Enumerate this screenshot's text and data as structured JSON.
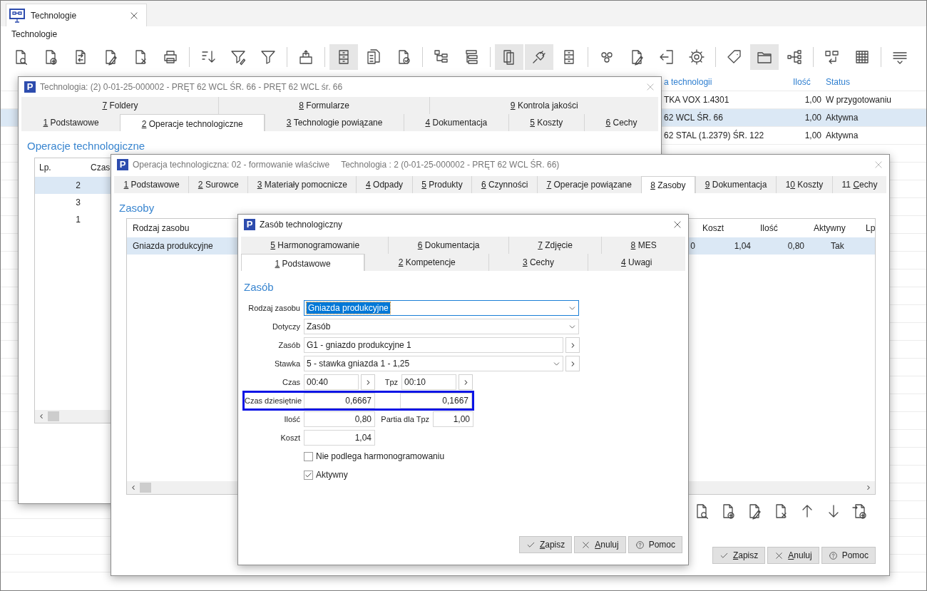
{
  "app_tab": {
    "label": "Technologie"
  },
  "page_title": "Technologie",
  "toolbar": [
    {
      "kind": "doc-search",
      "pressed": false
    },
    {
      "kind": "doc-add",
      "pressed": false
    },
    {
      "kind": "doc-copy",
      "pressed": false
    },
    {
      "kind": "doc-edit",
      "pressed": false
    },
    {
      "kind": "doc-delete",
      "pressed": false
    },
    {
      "kind": "printer",
      "pressed": false
    },
    {
      "kind": "separator"
    },
    {
      "kind": "sort",
      "pressed": false
    },
    {
      "kind": "filter-edit",
      "pressed": false
    },
    {
      "kind": "filter",
      "pressed": false
    },
    {
      "kind": "separator"
    },
    {
      "kind": "tray-upload",
      "pressed": false
    },
    {
      "kind": "separator"
    },
    {
      "kind": "cabinet",
      "pressed": true
    },
    {
      "kind": "doc-list",
      "pressed": false
    },
    {
      "kind": "doc-check",
      "pressed": false
    },
    {
      "kind": "separator"
    },
    {
      "kind": "hierarchy",
      "pressed": false
    },
    {
      "kind": "tree-list",
      "pressed": false
    },
    {
      "kind": "separator"
    },
    {
      "kind": "pages",
      "pressed": true
    },
    {
      "kind": "plug",
      "pressed": true
    },
    {
      "kind": "cabinet",
      "pressed": false
    },
    {
      "kind": "separator"
    },
    {
      "kind": "gears",
      "pressed": false
    },
    {
      "kind": "doc-edit",
      "pressed": false
    },
    {
      "kind": "sign-in",
      "pressed": false
    },
    {
      "kind": "gear",
      "pressed": false
    },
    {
      "kind": "separator"
    },
    {
      "kind": "tag",
      "pressed": false
    },
    {
      "kind": "folder",
      "pressed": true
    },
    {
      "kind": "network",
      "pressed": false
    },
    {
      "kind": "separator"
    },
    {
      "kind": "outdent",
      "pressed": false
    },
    {
      "kind": "grid",
      "pressed": false
    },
    {
      "kind": "separator"
    },
    {
      "kind": "menu-lines",
      "pressed": false
    }
  ],
  "background_list": {
    "columns": [
      {
        "label": "a technologii"
      },
      {
        "label": "Ilość"
      },
      {
        "label": "Status"
      }
    ],
    "rows": [
      {
        "name": "TKA VOX 1.4301",
        "quantity": "1,00",
        "status": "W przygotowaniu",
        "selected": false
      },
      {
        "name": "62 WCL ŚR. 66",
        "quantity": "1,00",
        "status": "Aktywna",
        "selected": true
      },
      {
        "name": "62 STAL (1.2379) ŚR. 122",
        "quantity": "1,00",
        "status": "Aktywna",
        "selected": false
      }
    ]
  },
  "technology_window": {
    "logo": "P",
    "title": "Technologia: (2) 0-01-25-000002 - PRĘT 62 WCL ŚR. 66 - PRĘT 62 WCL śr. 66",
    "tab_rows": [
      [
        {
          "key": "7",
          "post": " Foldery",
          "selected": false
        },
        {
          "key": "8",
          "post": " Formularze",
          "selected": false
        },
        {
          "key": "9",
          "post": " Kontrola jakości",
          "selected": false
        }
      ],
      [
        {
          "key": "1",
          "post": " Podstawowe",
          "selected": false
        },
        {
          "key": "2",
          "post": " Operacje technologiczne",
          "selected": true
        },
        {
          "key": "3",
          "post": " Technologie powiązane",
          "selected": false
        },
        {
          "key": "4",
          "post": " Dokumentacja",
          "selected": false
        },
        {
          "key": "5",
          "post": " Koszty",
          "selected": false
        },
        {
          "key": "6",
          "post": " Cechy",
          "selected": false
        }
      ]
    ],
    "section_title": "Operacje technologiczne",
    "table": {
      "columns": [
        {
          "label": "Lp."
        },
        {
          "label": "Czas"
        }
      ],
      "rows": [
        {
          "lp": "2",
          "selected": true
        },
        {
          "lp": "3",
          "selected": false
        },
        {
          "lp": "1",
          "selected": false
        }
      ]
    }
  },
  "operation_window": {
    "logo": "P",
    "title": "Operacja technologiczna: 02 - formowanie właściwe",
    "subtitle": "Technologia : 2 (0-01-25-000002 - PRĘT 62 WCL ŚR. 66)",
    "tabs": [
      {
        "key": "1",
        "post": " Podstawowe",
        "selected": false
      },
      {
        "key": "2",
        "post": " Surowce",
        "selected": false
      },
      {
        "key": "3",
        "post": " Materiały pomocnicze",
        "selected": false
      },
      {
        "key": "4",
        "post": " Odpady",
        "selected": false
      },
      {
        "key": "5",
        "post": " Produkty",
        "selected": false
      },
      {
        "key": "6",
        "post": " Czynności",
        "selected": false
      },
      {
        "key": "7",
        "post": " Operacje powiązane",
        "selected": false
      },
      {
        "key": "8",
        "post": " Zasoby",
        "selected": true
      },
      {
        "key": "9",
        "post": " Dokumentacja",
        "selected": false
      },
      {
        "pre": "1",
        "key": "0",
        "post": " Koszty",
        "selected": false
      },
      {
        "pre": "11 ",
        "key": "C",
        "post": "echy",
        "selected": false
      }
    ],
    "section_title": "Zasoby",
    "table": {
      "columns": {
        "rodzaj_zasobu": "Rodzaj zasobu",
        "koszt": "Koszt",
        "ilosc": "Ilość",
        "aktywny": "Aktywny",
        "lp": "Lp"
      },
      "rows": [
        {
          "rodzaj_zasobu": "Gniazda produkcyjne",
          "column_2": "0",
          "koszt": "1,04",
          "ilosc": "0,80",
          "aktywny": "Tak",
          "selected": true
        }
      ]
    },
    "tools": [
      {
        "kind": "doc-search"
      },
      {
        "kind": "doc-add"
      },
      {
        "kind": "doc-edit"
      },
      {
        "kind": "doc-delete"
      },
      {
        "kind": "arrow-up"
      },
      {
        "kind": "arrow-down"
      },
      {
        "kind": "doc-import"
      }
    ],
    "buttons": [
      {
        "kind": "save",
        "key": "Z",
        "post": "apisz"
      },
      {
        "kind": "cancel",
        "key": "A",
        "post": "nuluj"
      },
      {
        "kind": "help",
        "label": "Pomoc"
      }
    ]
  },
  "resource_window": {
    "logo": "P",
    "title": "Zasób technologiczny",
    "tab_rows": [
      [
        {
          "key": "5",
          "post": " Harmonogramowanie",
          "selected": false
        },
        {
          "key": "6",
          "post": " Dokumentacja",
          "selected": false
        },
        {
          "key": "7",
          "post": " Zdjęcie",
          "selected": false
        },
        {
          "key": "8",
          "post": " MES",
          "selected": false
        }
      ],
      [
        {
          "key": "1",
          "post": " Podstawowe",
          "selected": true
        },
        {
          "key": "2",
          "post": " Kompetencje",
          "selected": false
        },
        {
          "key": "3",
          "post": " Cechy",
          "selected": false
        },
        {
          "key": "4",
          "post": " Uwagi",
          "selected": false
        }
      ]
    ],
    "section_title": "Zasób",
    "form": {
      "rows": [
        {
          "kind": "select",
          "label": "Rodzaj zasobu",
          "value": "Gniazda produkcyjne",
          "focused": true
        },
        {
          "kind": "select",
          "label": "Dotyczy",
          "value": "Zasób",
          "focused": false
        },
        {
          "kind": "field-button",
          "label": "Zasób",
          "value": "G1 - gniazdo produkcyjne 1"
        },
        {
          "kind": "select-button",
          "label": "Stawka",
          "value": "5 - stawka gniazda 1 - 1,25"
        },
        {
          "kind": "time-pair",
          "label": "Czas",
          "value": "00:40",
          "label_2": "Tpz",
          "value_2": "00:10"
        },
        {
          "kind": "number-pair",
          "label": "Czas dziesiętnie",
          "value": "0,6667",
          "value_2": "0,1667",
          "highlighted": true
        },
        {
          "kind": "number-pair-labeled",
          "label": "Ilość",
          "value": "0,80",
          "label_2": "Partia dla Tpz",
          "value_2": "1,00"
        },
        {
          "kind": "number",
          "label": "Koszt",
          "value": "1,04"
        },
        {
          "kind": "checkbox",
          "label": "Nie podlega harmonogramowaniu",
          "checked": false
        },
        {
          "kind": "checkbox",
          "label": "Aktywny",
          "checked": true
        }
      ]
    },
    "buttons": [
      {
        "kind": "save",
        "key": "Z",
        "post": "apisz"
      },
      {
        "kind": "cancel",
        "key": "A",
        "post": "nuluj"
      },
      {
        "kind": "help",
        "label": "Pomoc"
      }
    ]
  }
}
